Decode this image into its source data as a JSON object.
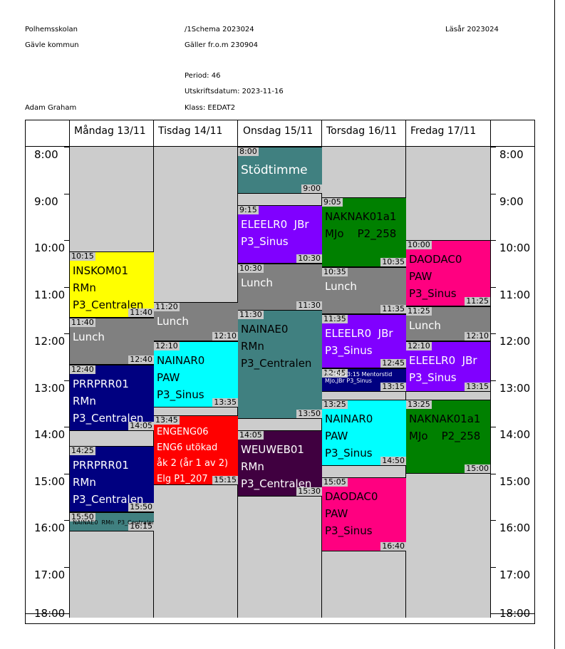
{
  "header": {
    "school": "Polhemsskolan",
    "municipality": "Gävle kommun",
    "schema": "/1Schema 2023024",
    "valid_from": "Gäller fr.o.m 230904",
    "year": "Läsår 2023024",
    "period": "Period: 46",
    "print_date": "Utskriftsdatum: 2023-11-16",
    "student": "Adam Graham",
    "class": "Klass: EEDAT2"
  },
  "days": [
    "Måndag 13/11",
    "Tisdag 14/11",
    "Onsdag 15/11",
    "Torsdag 16/11",
    "Fredag 17/11"
  ],
  "hours": [
    "8:00",
    "9:00",
    "10:00",
    "11:00",
    "12:00",
    "13:00",
    "14:00",
    "15:00",
    "16:00",
    "17:00",
    "18:00"
  ],
  "colors": {
    "yellow": "#ffff00",
    "gray": "#808080",
    "navy": "#000080",
    "teal": "#408080",
    "cyan": "#00ffff",
    "red": "#ff0000",
    "purple": "#8000ff",
    "green": "#008000",
    "pink": "#ff0080",
    "plum": "#400040",
    "background": "#cccccc"
  },
  "events": [
    {
      "day": 0,
      "start": "10:15",
      "end": "11:40",
      "lines": [
        "INSKOM01",
        "RMn",
        "P3_Centralen"
      ],
      "color": "#ffff00",
      "text": "#000000"
    },
    {
      "day": 0,
      "start": "11:40",
      "end": "12:40",
      "lines": [
        "Lunch"
      ],
      "color": "#808080",
      "text": "#ffffff"
    },
    {
      "day": 0,
      "start": "12:40",
      "end": "14:05",
      "lines": [
        "PRRPRR01",
        "RMn",
        "P3_Centralen"
      ],
      "color": "#000080",
      "text": "#ffffff"
    },
    {
      "day": 0,
      "start": "14:25",
      "end": "15:50",
      "lines": [
        "PRRPRR01",
        "RMn",
        "P3_Centralen"
      ],
      "color": "#000080",
      "text": "#ffffff"
    },
    {
      "day": 0,
      "start": "15:50",
      "end": "16:15",
      "lines": [
        "NAINAE0  RMn  P3_Centralen"
      ],
      "color": "#408080",
      "text": "#000000",
      "small": true
    },
    {
      "day": 1,
      "start": "11:20",
      "end": "12:10",
      "lines": [
        "Lunch"
      ],
      "color": "#808080",
      "text": "#ffffff"
    },
    {
      "day": 1,
      "start": "12:10",
      "end": "13:35",
      "lines": [
        "NAINAR0",
        "PAW",
        "P3_Sinus"
      ],
      "color": "#00ffff",
      "text": "#000000"
    },
    {
      "day": 1,
      "start": "13:45",
      "end": "15:15",
      "lines": [
        "ENGENG06",
        "ENG6 utökad",
        "åk 2 (år 1 av 2)",
        "Elg P1_207"
      ],
      "color": "#ff0000",
      "text": "#ffffff",
      "compact": true
    },
    {
      "day": 2,
      "start": "8:00",
      "end": "9:00",
      "lines": [
        "Stödtimme"
      ],
      "color": "#408080",
      "text": "#ffffff",
      "large": true
    },
    {
      "day": 2,
      "start": "9:15",
      "end": "10:30",
      "lines": [
        "ELEELR0  JBr",
        "P3_Sinus"
      ],
      "color": "#8000ff",
      "text": "#ffffff"
    },
    {
      "day": 2,
      "start": "10:30",
      "end": "11:30",
      "lines": [
        "Lunch"
      ],
      "color": "#808080",
      "text": "#ffffff"
    },
    {
      "day": 2,
      "start": "11:30",
      "end": "13:50",
      "lines": [
        "NAINAE0",
        "RMn",
        "P3_Centralen"
      ],
      "color": "#408080",
      "text": "#000000"
    },
    {
      "day": 2,
      "start": "14:05",
      "end": "15:30",
      "lines": [
        "WEUWEB01",
        "RMn",
        "P3_Centralen"
      ],
      "color": "#400040",
      "text": "#ffffff"
    },
    {
      "day": 3,
      "start": "9:05",
      "end": "10:35",
      "lines": [
        "NAKNAK01a1",
        "MJo    P2_258"
      ],
      "color": "#008000",
      "text": "#000000"
    },
    {
      "day": 3,
      "start": "10:35",
      "end": "11:35",
      "lines": [
        "Lunch"
      ],
      "color": "#808080",
      "text": "#ffffff"
    },
    {
      "day": 3,
      "start": "11:35",
      "end": "12:45",
      "lines": [
        "ELEELR0  JBr",
        "P3_Sinus"
      ],
      "color": "#8000ff",
      "text": "#ffffff"
    },
    {
      "day": 3,
      "start": "12:45",
      "end": "13:15",
      "lines": [
        "12:45-13:15 Mentorstid",
        "MJo,JBr P3_Sinus"
      ],
      "color": "#000080",
      "text": "#ffffff",
      "small": true
    },
    {
      "day": 3,
      "start": "13:25",
      "end": "14:50",
      "lines": [
        "NAINAR0",
        "PAW",
        "P3_Sinus"
      ],
      "color": "#00ffff",
      "text": "#000000"
    },
    {
      "day": 3,
      "start": "15:05",
      "end": "16:40",
      "lines": [
        "DAODAC0",
        "PAW",
        "P3_Sinus"
      ],
      "color": "#ff0080",
      "text": "#000000"
    },
    {
      "day": 4,
      "start": "10:00",
      "end": "11:25",
      "lines": [
        "DAODAC0",
        "PAW",
        "P3_Sinus"
      ],
      "color": "#ff0080",
      "text": "#000000"
    },
    {
      "day": 4,
      "start": "11:25",
      "end": "12:10",
      "lines": [
        "Lunch"
      ],
      "color": "#808080",
      "text": "#ffffff"
    },
    {
      "day": 4,
      "start": "12:10",
      "end": "13:15",
      "lines": [
        "ELEELR0  JBr",
        "P3_Sinus"
      ],
      "color": "#8000ff",
      "text": "#ffffff"
    },
    {
      "day": 4,
      "start": "13:25",
      "end": "15:00",
      "lines": [
        "NAKNAK01a1",
        "MJo    P2_258"
      ],
      "color": "#008000",
      "text": "#000000"
    }
  ]
}
